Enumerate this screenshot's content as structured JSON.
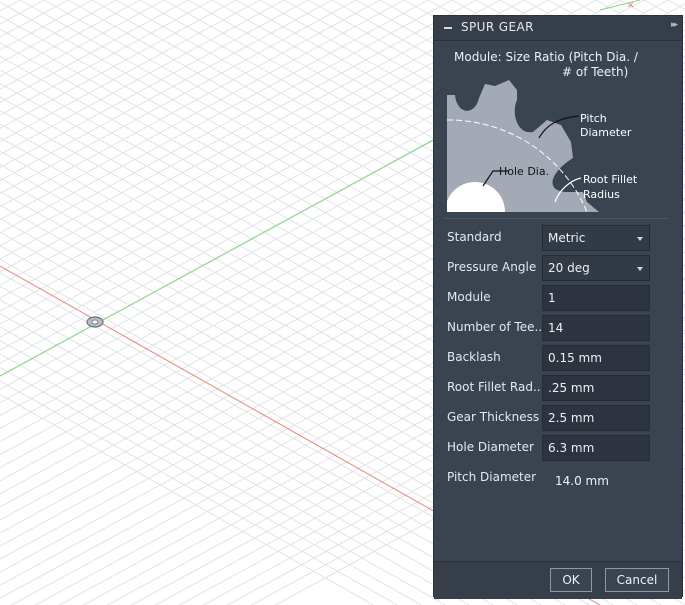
{
  "dialog": {
    "title": "SPUR GEAR",
    "description_line1": "Module: Size Ratio (Pitch Dia. /",
    "description_line2": "# of Teeth)",
    "diagram_labels": {
      "pitch_line1": "Pitch",
      "pitch_line2": "Diameter",
      "hole": "Hole Dia.",
      "root_line1": "Root Fillet",
      "root_line2": "Radius"
    },
    "fields": [
      {
        "label": "Standard",
        "value": "Metric",
        "type": "select"
      },
      {
        "label": "Pressure Angle",
        "value": "20 deg",
        "type": "select"
      },
      {
        "label": "Module",
        "value": "1",
        "type": "input"
      },
      {
        "label": "Number of Tee...",
        "value": "14",
        "type": "input"
      },
      {
        "label": "Backlash",
        "value": "0.15 mm",
        "type": "input"
      },
      {
        "label": "Root Fillet Rad...",
        "value": ".25 mm",
        "type": "input"
      },
      {
        "label": "Gear Thickness",
        "value": "2.5 mm",
        "type": "input"
      },
      {
        "label": "Hole Diameter",
        "value": "6.3 mm",
        "type": "input"
      }
    ],
    "pitch_diameter": {
      "label": "Pitch Diameter",
      "value": "14.0 mm"
    },
    "buttons": {
      "ok": "OK",
      "cancel": "Cancel"
    }
  },
  "colors": {
    "panel_bg": "#3a4350",
    "field_bg": "#2d3440",
    "gear_fill": "#a3a9b5",
    "x_axis": "#e87c72",
    "y_axis": "#7dd87a",
    "grid": "#dfe3e8"
  },
  "icons": [
    "collapse-icon",
    "expand-icon",
    "dropdown-caret-icon",
    "origin-icon"
  ]
}
